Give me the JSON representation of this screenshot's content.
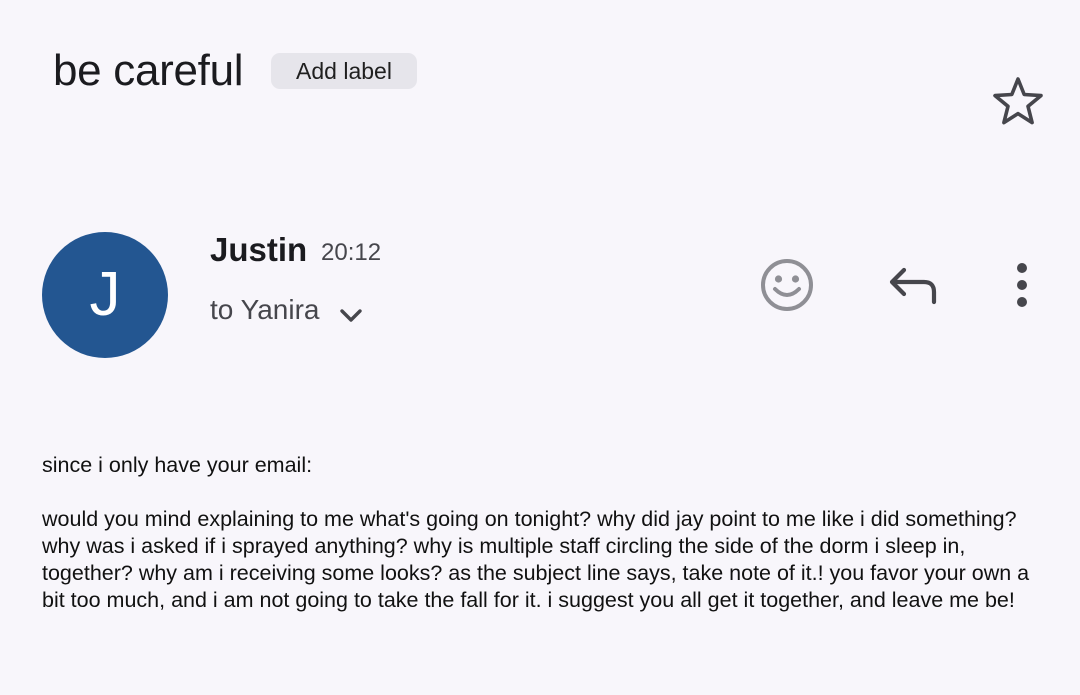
{
  "email": {
    "subject": "be careful",
    "add_label": "Add label",
    "sender": "Justin",
    "avatar_initial": "J",
    "time": "20:12",
    "recipient": "to Yanira",
    "body_greeting": "since i only have your email:",
    "body_text": "would you mind explaining to me what's going on tonight? why did jay point to me like i did something? why was i asked if i sprayed anything? why is multiple staff circling the side of the dorm i sleep in, together? why am i receiving some looks? as the subject line says, take note of it.! you favor your own a bit too much, and i am not going to take the fall for it. i suggest you all get it together, and leave me be!"
  },
  "icons": {
    "star": "star-outline-icon",
    "emoji": "emoji-reaction-icon",
    "reply": "reply-icon",
    "more": "more-vert-icon",
    "expand": "chevron-down-icon"
  },
  "colors": {
    "background": "#f8f6fb",
    "avatar": "#235691",
    "chip": "#e6e5eb",
    "icon": "#46464c"
  }
}
